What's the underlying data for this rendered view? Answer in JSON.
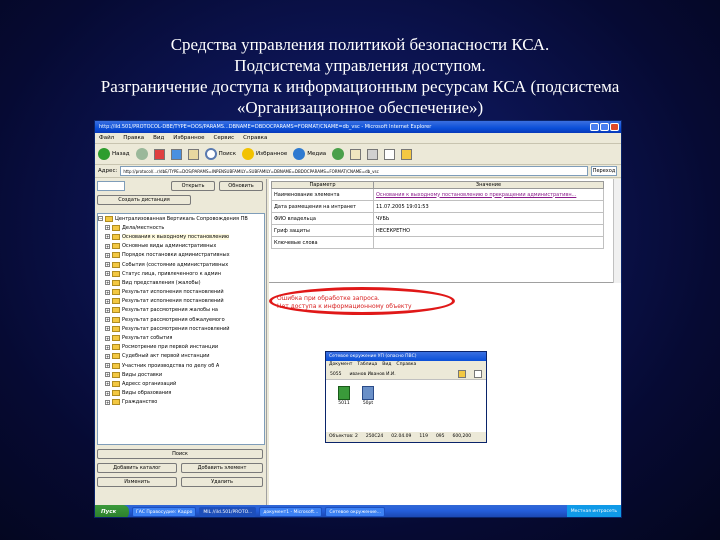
{
  "slide": {
    "title_lines": [
      "Средства управления политикой безопасности КСА.",
      "Подсистема управления доступом.",
      "Разграничение доступа к информационным ресурсам КСА (подсистема",
      "«Организационное обеспечение»)"
    ]
  },
  "browser": {
    "window_title": "http://ild.501/PROTOCOL-DBE/TYPE=DOS/PARAMS...DBNAME=DBDOCPARAMS=FORMAT/CNAME=db_vsc - Microsoft Internet Explorer",
    "menu": [
      "Файл",
      "Правка",
      "Вид",
      "Избранное",
      "Сервис",
      "Справка"
    ],
    "toolbar": {
      "back": "Назад",
      "search": "Поиск",
      "favorites": "Избранное",
      "media": "Медиа"
    },
    "address_label": "Адрес:",
    "address_value": "http://protocol/...r/dbE/TYPE=DOS/PARAMS=INPENSUBFAMILY=SUBFAMILY=DBNAME=DBDOCPARAMS=FORMAT/CNAME=db_vsc",
    "go_label": "Переход"
  },
  "left_panel": {
    "open_button": "Открыть",
    "refresh_button": "Обновить",
    "create_button": "Создать дистанция",
    "tree_root": "Централизованная Вертикаль Сопровождения ПВ",
    "tree_items": [
      "Дела/местность",
      "Основания к выходному постановлению",
      "Основные виды административных",
      "Порядок постановки административных",
      "События (состояние административных",
      "Статус лица, привлеченного к админ",
      "Вид представления (жалобы)",
      "Результат исполнения постановлений",
      "Результат исполнения постановлений",
      "Результат рассмотрения жалобы на",
      "Результат рассмотрения обжалуемого",
      "Результат рассмотрения постановлений",
      "Результат события",
      "Росмотрение при первой инстанции",
      "Судебный акт первой инстанции",
      "Участник производства по делу об А",
      "Виды доставки",
      "Адресс организаций",
      "Виды образования",
      "Гражданство"
    ],
    "search_button": "Поиск",
    "add_catalog_button": "Добавить каталог",
    "add_element_button": "Добавить элемент",
    "change_button": "Изменить",
    "delete_button": "Удалить"
  },
  "params_table": {
    "headers": [
      "Параметр",
      "Значение"
    ],
    "rows": [
      {
        "param": "Наименование элемента",
        "value": "Основания к выходному постановлению о прекращении административн..."
      },
      {
        "param": "Дата размещения на интранет",
        "value": "11.07.2005 19:01:53"
      },
      {
        "param": "ФИО владельца",
        "value": "ЧУБЬ"
      },
      {
        "param": "Гриф защиты",
        "value": "НЕСЕКРЕТНО"
      },
      {
        "param": "Ключевые слова",
        "value": ""
      }
    ]
  },
  "error": {
    "line1": "Ошибка при обработке запроса.",
    "line2": "Нет доступа к информационному объекту"
  },
  "explorer_window": {
    "title": "Сетевое окружение УП (опасно ПВС)",
    "menu": [
      "Документ",
      "Таблица",
      "Вид",
      "Справка"
    ],
    "user_id": "5055",
    "user_name": "иванов Иванов И.И.",
    "icons": [
      "5011",
      "50pt"
    ],
    "status": [
      "Объектов: 2",
      "250С24",
      "02.04.09",
      "119",
      "095",
      "600,200"
    ]
  },
  "taskbar": {
    "start": "Пуск",
    "tasks": [
      "ГАС Правосудие: Кадро",
      "MIL //ild.501/PROTO...",
      "документ1 - Microsoft...",
      "Сетевое окружение..."
    ],
    "tray_text": "Местная интрасеть"
  },
  "colors": {
    "slide_bg": "#0c1452",
    "title_text": "#ffffff",
    "error_text": "#d82020",
    "highlight_oval": "#e01818",
    "link_value": "#8a1a8a"
  }
}
